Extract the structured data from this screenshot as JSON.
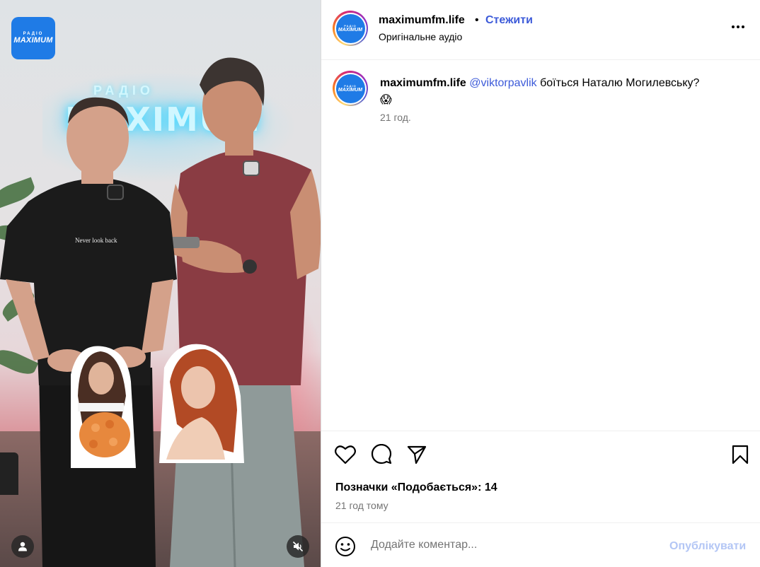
{
  "media": {
    "badge_top": "РАДІО",
    "badge_brand": "MAXIMUM",
    "neon_top": "РАДІО",
    "neon_main": "MAXIMUM",
    "shirt_print": "Never look back",
    "user_tag_icon": "person-icon",
    "mute_icon": "speaker-muted-icon"
  },
  "post": {
    "username": "maximumfm.life",
    "separator": "•",
    "follow_label": "Стежити",
    "audio_label": "Оригінальне аудіо",
    "more_icon": "more-horizontal-icon",
    "avatar_top": "РАДІО",
    "avatar_brand": "MAXIMUM"
  },
  "caption": {
    "username": "maximumfm.life",
    "mention": "@viktorpavlik",
    "text": " боїться Наталю Могилевську?",
    "emoji": "😱",
    "time": "21 год."
  },
  "actions": {
    "like_icon": "heart-icon",
    "comment_icon": "comment-icon",
    "share_icon": "send-icon",
    "save_icon": "bookmark-icon",
    "likes_text": "Позначки «Подобається»: 14",
    "posted_ago": "21 год тому"
  },
  "comment": {
    "emoji_icon": "smiley-icon",
    "placeholder": "Додайте коментар...",
    "publish_label": "Опублікувати"
  },
  "colors": {
    "accent": "#3d5bd9",
    "publish_disabled": "#b3c6f5",
    "brand_blue": "#1f7be6",
    "muted_text": "#737373"
  }
}
